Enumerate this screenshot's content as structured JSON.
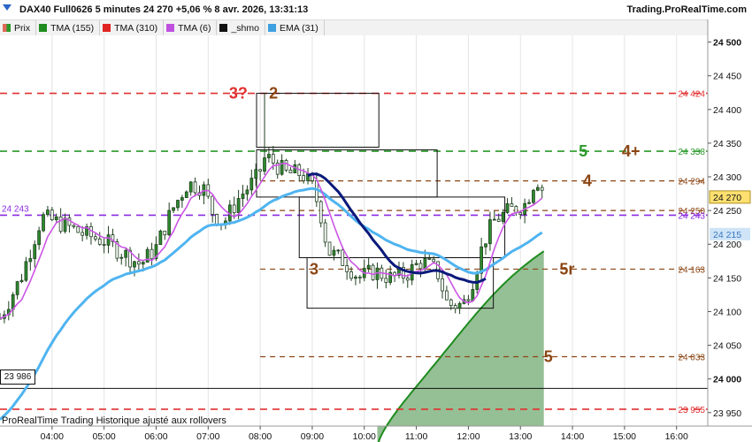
{
  "header": {
    "title": "DAX40 Full0626 5 minutes 24 270 +5,06 % 8 avr. 2026, 13:31:13",
    "brand": "Trading.ProRealTime.com"
  },
  "legend": [
    {
      "label": "Prix",
      "color": "#e06a5a"
    },
    {
      "label": "TMA (155)",
      "color": "#1e8c1e"
    },
    {
      "label": "TMA (310)",
      "color": "#e02424"
    },
    {
      "label": "TMA (6)",
      "color": "#c050e0"
    },
    {
      "label": "_shmo",
      "color": "#111111"
    },
    {
      "label": "EMA (31)",
      "color": "#3fa0e0"
    }
  ],
  "footer": {
    "text": "ProRealTime Trading  Historique ajusté aux rollovers"
  },
  "left_price_box": "23 986",
  "chart_data": {
    "type": "candlestick",
    "y_axis": {
      "min": 23930,
      "max": 24510,
      "ticks": [
        23950,
        24000,
        24050,
        24100,
        24150,
        24200,
        24250,
        24300,
        24350,
        24400,
        24450,
        24500
      ],
      "tick_labels": [
        "23 950",
        "24 000",
        "24 050",
        "24 100",
        "24 150",
        "24 200",
        "24 250",
        "24 300",
        "24 350",
        "24 400",
        "24 450",
        "24 500"
      ]
    },
    "x_axis": {
      "labels": [
        "04:00",
        "05:00",
        "06:00",
        "07:00",
        "08:00",
        "09:00",
        "10:00",
        "11:00",
        "12:00",
        "13:00",
        "14:00",
        "15:00",
        "16:00"
      ],
      "hours": [
        4,
        5,
        6,
        7,
        8,
        9,
        10,
        11,
        12,
        13,
        14,
        15,
        16
      ],
      "min_hour": 3.0,
      "max_hour": 16.6
    },
    "levels": [
      {
        "value": 24424,
        "label": "24 424",
        "color": "#e03030",
        "full": true
      },
      {
        "value": 24338,
        "label": "24 338",
        "color": "#2a9a2a",
        "full": true
      },
      {
        "value": 24294,
        "label": "24 294",
        "color": "#8b4513",
        "full": false
      },
      {
        "value": 24250,
        "label": "24 250",
        "color": "#8b4513",
        "full": false
      },
      {
        "value": 24243,
        "label": "24 243",
        "color": "#8a2be2",
        "full": true
      },
      {
        "value": 24163,
        "label": "24 163",
        "color": "#8b4513",
        "full": false
      },
      {
        "value": 24033,
        "label": "24 033",
        "color": "#8b4513",
        "full": false
      },
      {
        "value": 23955,
        "label": "23 955",
        "color": "#e03030",
        "full": true
      }
    ],
    "current_price": {
      "value": 24270,
      "label": "24 270"
    },
    "ema_last": {
      "value": 24215,
      "label": "24 215"
    },
    "black_line": {
      "value": 23986
    },
    "annotations": [
      {
        "text": "3?",
        "hour": 7.4,
        "value": 24424,
        "color": "#e03030"
      },
      {
        "text": "2",
        "hour": 8.17,
        "value": 24424,
        "color": "#8b4513"
      },
      {
        "text": "3",
        "hour": 8.95,
        "value": 24163,
        "color": "#8b4513"
      },
      {
        "text": "5",
        "hour": 14.12,
        "value": 24338,
        "color": "#2a9a2a"
      },
      {
        "text": "4+",
        "hour": 14.95,
        "value": 24338,
        "color": "#8b4513"
      },
      {
        "text": "4",
        "hour": 14.2,
        "value": 24294,
        "color": "#8b4513"
      },
      {
        "text": "5r",
        "hour": 13.75,
        "value": 24163,
        "color": "#8b4513"
      },
      {
        "text": "5",
        "hour": 13.45,
        "value": 24033,
        "color": "#8b4513"
      }
    ],
    "boxes": [
      {
        "h1": 7.93,
        "h2": 10.28,
        "low": 24344,
        "high": 24424
      },
      {
        "h1": 7.93,
        "h2": 11.4,
        "low": 24270,
        "high": 24340
      },
      {
        "h1": 8.75,
        "h2": 12.7,
        "low": 24180,
        "high": 24270
      },
      {
        "h1": 8.9,
        "h2": 12.48,
        "low": 24105,
        "high": 24180
      }
    ]
  }
}
